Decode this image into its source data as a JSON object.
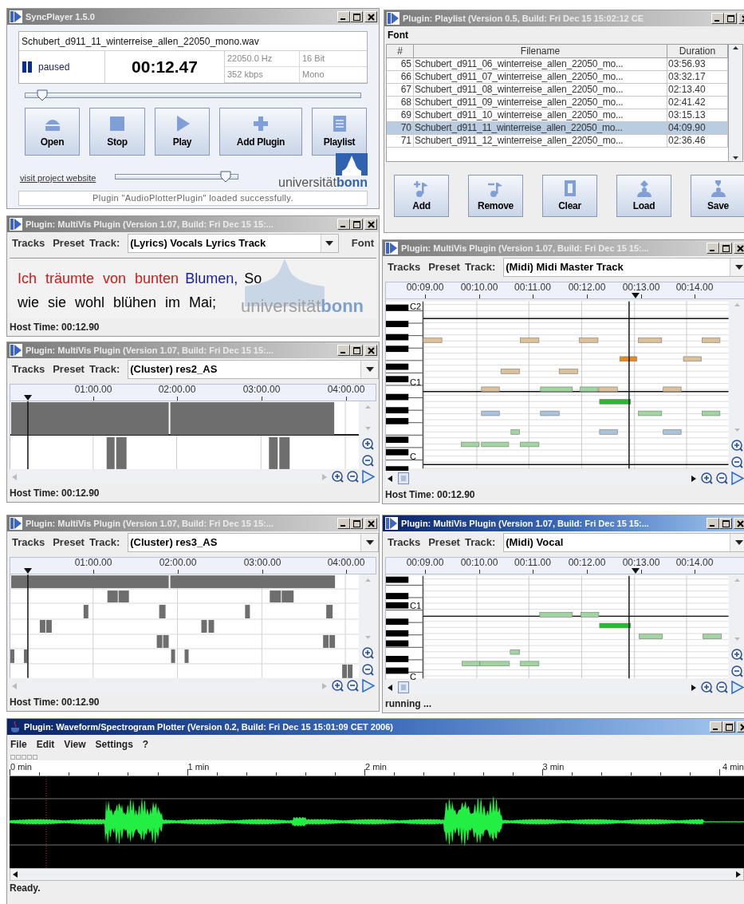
{
  "syncplayer": {
    "title": "SyncPlayer 1.5.0",
    "active": false,
    "filename": "Schubert_d911_11_winterreise_allen_22050_mono.wav",
    "status": "paused",
    "time": "00:12.47",
    "sample_rate": "22050.0 Hz",
    "bit_depth": "16 Bit",
    "bitrate": "352 kbps",
    "channels": "Mono",
    "position": {
      "level": 0.05
    },
    "buttons": [
      "Open",
      "Stop",
      "Play",
      "Add Plugin",
      "Playlist"
    ],
    "link": "visit project website",
    "volume": {
      "level": 0.9
    },
    "logo": "universität**bonn**",
    "message": "Plugin \"AudioPlotterPlugin\" loaded successfully."
  },
  "playlist": {
    "title": "Plugin: Playlist (Version 0.5, Build: Fri Dec 15 15:02:12 CE",
    "active": false,
    "menu": [
      "Font"
    ],
    "columns": [
      "#",
      "Filename",
      "Duration"
    ],
    "rows": [
      {
        "number": "65",
        "filename": "Schubert_d911_06_winterreise_allen_22050_mo...",
        "duration": "03:56.93",
        "selected": false
      },
      {
        "number": "66",
        "filename": "Schubert_d911_07_winterreise_allen_22050_mo...",
        "duration": "03:32.17",
        "selected": false
      },
      {
        "number": "67",
        "filename": "Schubert_d911_08_winterreise_allen_22050_mo...",
        "duration": "02:13.40",
        "selected": false
      },
      {
        "number": "68",
        "filename": "Schubert_d911_09_winterreise_allen_22050_mo...",
        "duration": "02:41.42",
        "selected": false
      },
      {
        "number": "69",
        "filename": "Schubert_d911_10_winterreise_allen_22050_mo...",
        "duration": "03:15.13",
        "selected": false
      },
      {
        "number": "70",
        "filename": "Schubert_d911_11_winterreise_allen_22050_mo...",
        "duration": "04:09.90",
        "selected": true
      },
      {
        "number": "71",
        "filename": "Schubert_d911_12_winterreise_allen_22050_mo...",
        "duration": "02:36.46",
        "selected": false
      }
    ],
    "buttons": [
      "Add",
      "Remove",
      "Clear",
      "Load",
      "Save"
    ]
  },
  "left_plugins": [
    {
      "kind": "lyrics",
      "title": "Plugin: MultiVis Plugin (Version 1.07, Build: Fri Dec 15 15:...",
      "active": false,
      "menus": [
        "Tracks",
        "Preset"
      ],
      "track_label": "Track:",
      "track": "(Lyrics) Vocals Lyrics Track",
      "font_button": "Font",
      "background_logo": "universität**bonn**",
      "lines": [
        [
          {
            "text": "Ich träumte von bunten",
            "kind": "sung"
          },
          {
            "text": "Blumen,",
            "kind": "current"
          },
          {
            "text": "So",
            "kind": "upcoming"
          }
        ],
        [
          {
            "text": "wie sie wohl blühen im Mai;",
            "kind": "upcoming"
          }
        ]
      ],
      "footer": "Host Time: 00:12.90"
    },
    {
      "kind": "cluster",
      "title": "Plugin: MultiVis Plugin (Version 1.07, Build: Fri Dec 15 15:...",
      "active": false,
      "menus": [
        "Tracks",
        "Preset"
      ],
      "track_label": "Track:",
      "track": "(Cluster) res2_AS",
      "ruler": [
        "01:00.00",
        "02:00.00",
        "03:00.00",
        "04:00.00"
      ],
      "footer": "Host Time: 00:12.90"
    },
    {
      "kind": "cluster",
      "title": "Plugin: MultiVis Plugin (Version 1.07, Build: Fri Dec 15 15:...",
      "active": false,
      "menus": [
        "Tracks",
        "Preset"
      ],
      "track_label": "Track:",
      "track": "(Cluster) res3_AS",
      "ruler": [
        "01:00.00",
        "02:00.00",
        "03:00.00",
        "04:00.00"
      ],
      "footer": "Host Time: 00:12.90"
    }
  ],
  "right_plugins": [
    {
      "kind": "midi",
      "title": "Plugin: MultiVis Plugin (Version 1.07, Build: Fri Dec 15 15:...",
      "active": false,
      "menus": [
        "Tracks",
        "Preset"
      ],
      "track_label": "Track:",
      "track": "(Midi) Midi Master Track",
      "ruler": [
        "00:09.00",
        "00:10.00",
        "00:11.00",
        "00:12.00",
        "00:13.00",
        "00:14.00"
      ],
      "keys": [
        "C2",
        "C1",
        "C"
      ],
      "footer": "Host Time: 00:12.90"
    },
    {
      "kind": "midi",
      "title": "Plugin: MultiVis Plugin (Version 1.07, Build: Fri Dec 15 15:...",
      "active": true,
      "menus": [
        "Tracks",
        "Preset"
      ],
      "track_label": "Track:",
      "track": "(Midi) Vocal",
      "ruler": [
        "00:09.00",
        "00:10.00",
        "00:11.00",
        "00:12.00",
        "00:13.00",
        "00:14.00"
      ],
      "keys": [
        "C1",
        "C"
      ],
      "footer": "running ..."
    }
  ],
  "waveform": {
    "title": "Plugin: Waveform/Spectrogram Plotter (Version 0.2, Build: Fri Dec 15 15:01:09 CET 2006)",
    "active": true,
    "menu": [
      "File",
      "Edit",
      "View",
      "Settings",
      "?"
    ],
    "ruler": [
      "0 min",
      "1 min",
      "2 min",
      "3 min",
      "4 min"
    ],
    "status": "Ready."
  }
}
